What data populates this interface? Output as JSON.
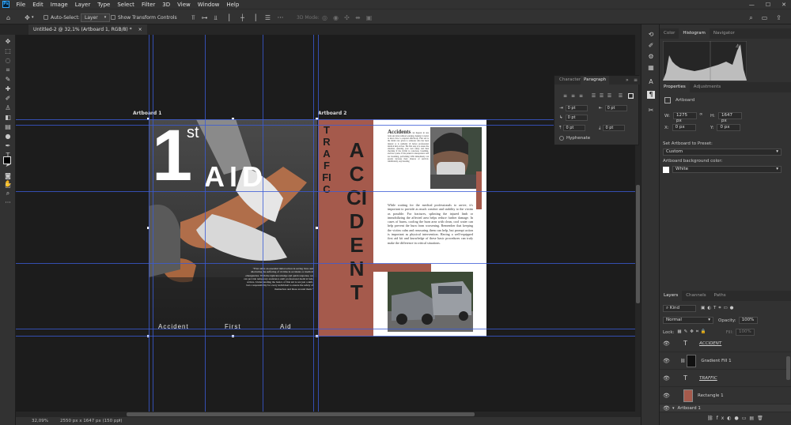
{
  "menubar": {
    "logo": "Ps",
    "items": [
      "File",
      "Edit",
      "Image",
      "Layer",
      "Type",
      "Select",
      "Filter",
      "3D",
      "View",
      "Window",
      "Help"
    ],
    "window_controls": [
      "—",
      "☐",
      "✕"
    ]
  },
  "options": {
    "auto_select_label": "Auto-Select:",
    "auto_select_value": "Layer",
    "show_transform_label": "Show Transform Controls",
    "mode_label": "3D Mode:"
  },
  "document": {
    "tab_title": "Untitled-2 @ 32,1% (Artboard 1, RGB/8) *",
    "tab_close": "×"
  },
  "status": {
    "zoom": "32,09%",
    "size": "2550 px x 1647 px (150 ppi)"
  },
  "artboard1": {
    "label": "Artboard 1",
    "big_number": "1",
    "superscript": "st",
    "word": "AID",
    "body": "\"First aid is an essential initial action in saving lives and alleviating the suffering of victims in accidents or medical emergencies. With the right knowledge and quick response, we can provide temporary assistance until professional medical help arrives. Understanding the basics of first aid is not just a skill, but a responsibility for every individual to ensure the safety of themselves and those around them.\"",
    "footer": [
      "Accident",
      "First",
      "Aid"
    ]
  },
  "artboard2": {
    "label": "Artboard 2",
    "traffic": "TRAFFIC",
    "accident": "ACCIDENT",
    "article_title": "Accidents",
    "article_intro": "can happen in any form and often without warning, making it crucial to know how to respond effectively. First aid is the initial care given to someone who has been injured or is suddenly ill before professional medical help arrives. The first step is to assess the situation, ensuring your own safety and then checking if the victim is conscious, breathing, and has a pulse. If the patient is unresponsive and not breathing, performing CPR immediately can greatly increase their chances of survival. Additionally, any bleeding",
    "article_body": "While waiting for the medical professionals to arrive, it's important to provide as much comfort and stability to the victim as possible. For fractures, splinting the injured limb or immobilizing the affected area helps reduce further damage. In cases of burns, cooling the burn area with clean, cool water can help prevent the burn from worsening. Remember that keeping the victim calm and reassuring them can help, but prompt action is important as physical intervention. Having a well-equipped first aid kit and knowledge of these basic procedures can truly make the difference in critical situations."
  },
  "panels": {
    "top_tabs": [
      "Color",
      "Histogram",
      "Navigator"
    ],
    "properties_tabs": [
      "Properties",
      "Adjustments"
    ],
    "artboard_label": "Artboard",
    "w_label": "W:",
    "w_value": "1275 px",
    "h_label": "H:",
    "h_value": "1647 px",
    "x_label": "X:",
    "x_value": "0 px",
    "y_label": "Y:",
    "y_value": "0 px",
    "preset_label": "Set Artboard to Preset:",
    "preset_value": "Custom",
    "bg_label": "Artboard background color:",
    "bg_value": "White",
    "layers_tabs": [
      "Layers",
      "Channels",
      "Paths"
    ],
    "kind_label": "Kind",
    "blend_mode": "Normal",
    "opacity_label": "Opacity:",
    "opacity_value": "100%",
    "lock_label": "Lock:",
    "fill_label": "Fill:",
    "fill_value": "100%",
    "layers": [
      {
        "name": "ACCIDENT",
        "kind": "T"
      },
      {
        "name": "Gradient Fill 1",
        "kind": "gradient"
      },
      {
        "name": "TRAFFIC",
        "kind": "T"
      },
      {
        "name": "Rectangle 1",
        "kind": "rect"
      },
      {
        "name": "Artboard 1",
        "kind": "group"
      }
    ]
  },
  "paragraph_panel": {
    "tabs": [
      "Character",
      "Paragraph"
    ],
    "indent_values": [
      "0 pt",
      "0 pt",
      "0 pt",
      "0 pt",
      "0 pt"
    ],
    "hyphenate_label": "Hyphenate"
  },
  "colors": {
    "accent_guide": "#3b5bd6",
    "artboard2_panel": "#a55a4c"
  }
}
